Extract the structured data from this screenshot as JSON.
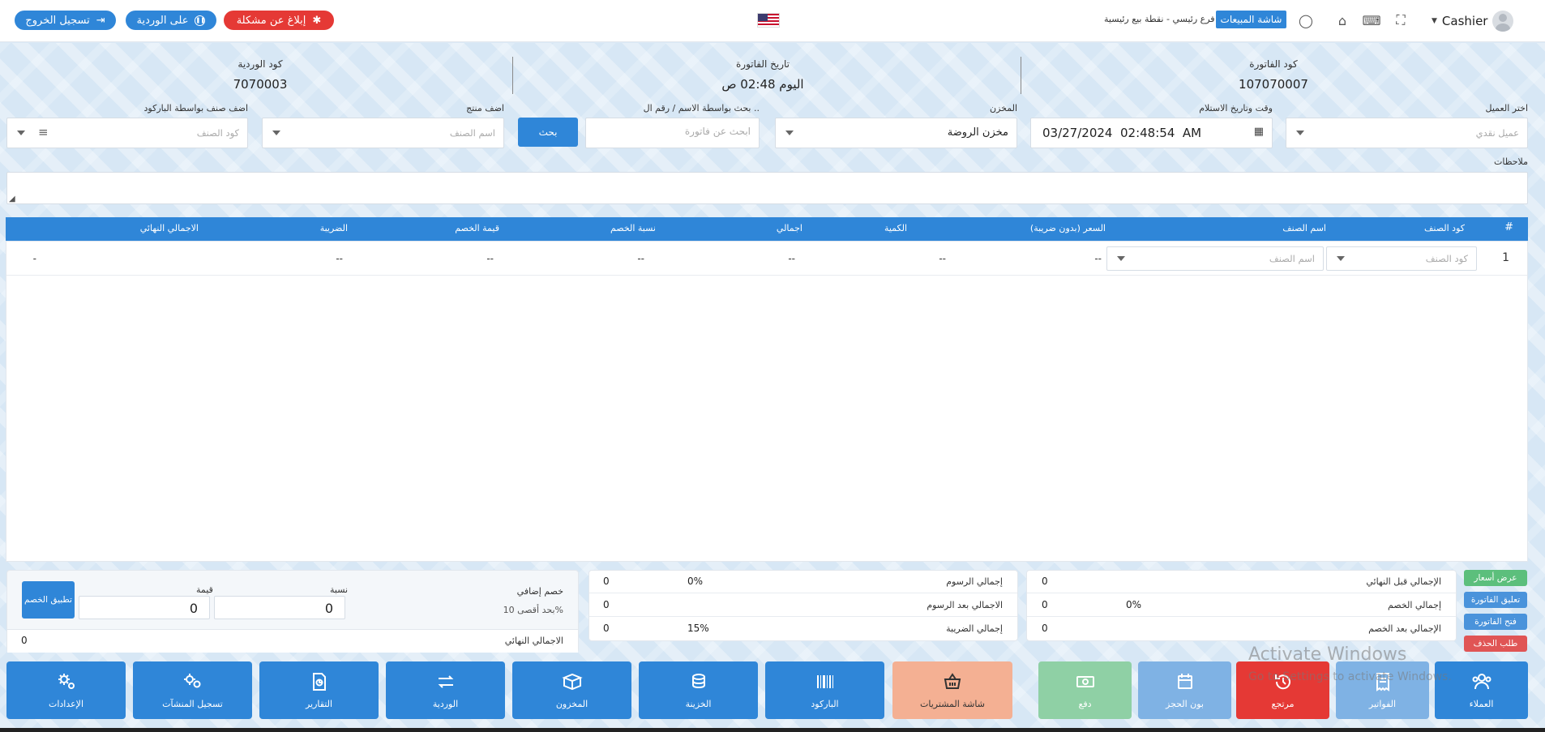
{
  "topbar": {
    "logout": "تسجيل الخروج",
    "shift": "على الوردية",
    "report": "إبلاغ عن مشكلة",
    "user": "Cashier",
    "sales_screen": "شاشة المبيعات",
    "branch": "فرع رئيسي - نقطة بيع رئيسية"
  },
  "invoice": {
    "code_label": "كود الفاتورة",
    "code": "107070007",
    "date_label": "تاريخ الفاتورة",
    "date": "اليوم 02:48 ص",
    "shift_label": "كود الوردية",
    "shift_code": "7070003"
  },
  "form": {
    "customer_label": "اختر العميل",
    "customer_placeholder": "عميل نقدي",
    "receipt_label": "وقت وتاريخ الاستلام",
    "receipt_value": "03/27/2024  02:48:54  AM",
    "store_label": "المخزن",
    "store_value": "مخزن الروضة",
    "search_label": "بحث بواسطة الاسم / رقم ال ..",
    "search_placeholder": "ابحث عن فاتورة",
    "search_button": "بحث",
    "product_label": "اضف منتج",
    "product_placeholder": "اسم الصنف",
    "barcode_label": "اضف صنف بواسطة الباركود",
    "barcode_placeholder": "كود الصنف",
    "notes_label": "ملاحظات"
  },
  "table": {
    "headers": {
      "idx": "#",
      "code": "كود الصنف",
      "name": "اسم الصنف",
      "price": "السعر (بدون ضريبة)",
      "qty": "الكمية",
      "total": "اجمالي",
      "disc_pct": "نسبة الخصم",
      "disc_val": "قيمة الخصم",
      "tax": "الضريبة",
      "final": "الاجمالي النهائي"
    },
    "row": {
      "idx": "1",
      "code_placeholder": "كود الصنف",
      "name_placeholder": "اسم الصنف",
      "price": "--",
      "qty": "--",
      "total": "--",
      "disc_pct": "--",
      "disc_val": "--",
      "tax": "--",
      "final": "-"
    }
  },
  "summary_right": [
    {
      "label": "الإجمالي قبل النهائي",
      "value": "0",
      "extra": ""
    },
    {
      "label": "إجمالي الخصم",
      "value": "0",
      "extra": "0%"
    },
    {
      "label": "الإجمالي بعد الخصم",
      "value": "0",
      "extra": ""
    }
  ],
  "summary_mid": [
    {
      "label": "إجمالي الرسوم",
      "value": "0",
      "extra": "0%"
    },
    {
      "label": "الاجمالي بعد الرسوم",
      "value": "0",
      "extra": ""
    },
    {
      "label": "إجمالي الضريبة",
      "value": "0",
      "extra": "15%"
    }
  ],
  "discount": {
    "title": "خصم إضافي",
    "max": "بحد أقصى 10%",
    "pct_label": "نسبة",
    "pct_value": "0",
    "val_label": "قيمة",
    "val_value": "0",
    "apply": "تطبيق الخصم",
    "final_label": "الاجمالي النهائي",
    "final_value": "0"
  },
  "side_buttons": {
    "quote": "عرض أسعار",
    "suspend": "تعليق الفاتورة",
    "open": "فتح الفاتورة",
    "delete": "طلب الحذف"
  },
  "colors": {
    "primary": "#2f86d8",
    "danger": "#e53935",
    "success": "#5cbf7c",
    "salmon": "#f4b093",
    "ghost_blue": "#7fb2e4",
    "ghost_green": "#8fd0a5"
  },
  "bottom_buttons": {
    "customers": "العملاء",
    "invoices": "الفواتير",
    "returns": "مرتجع",
    "reserve": "بون الحجز",
    "pay": "دفع",
    "purchases": "شاشة المشتريات",
    "barcode": "الباركود",
    "treasury": "الخزينة",
    "stock": "المخزون",
    "shift": "الوردية",
    "reports": "التقارير",
    "devices": "تسجيل المنشآت",
    "settings": "الإعدادات"
  },
  "watermark": {
    "line1": "Activate Windows",
    "line2": "Go to Settings to activate Windows."
  }
}
